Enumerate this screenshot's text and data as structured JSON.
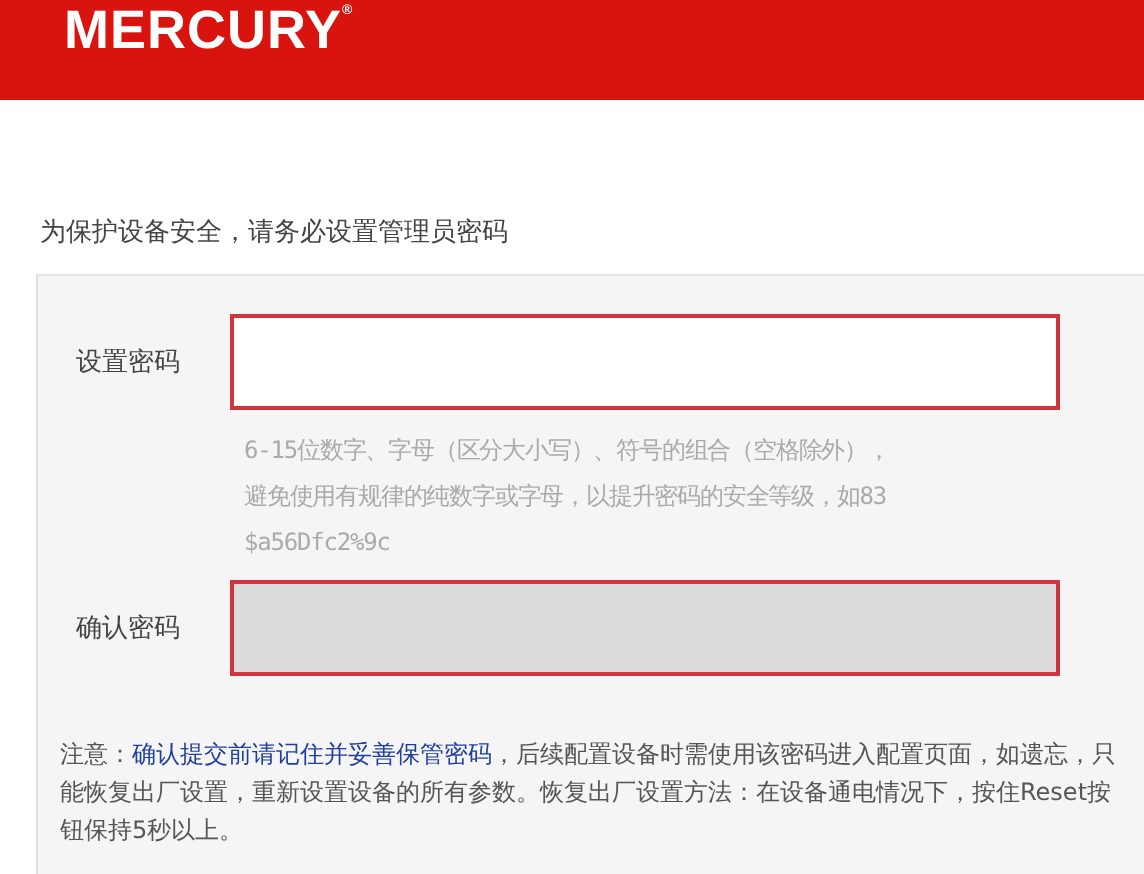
{
  "header": {
    "logo": "MERCURY",
    "trademark": "®"
  },
  "intro": "为保护设备安全，请务必设置管理员密码",
  "fields": [
    {
      "label": "设置密码",
      "disabled": false,
      "hint": [
        "6-15位数字、字母（区分大小写）、符号的组合（空格除外），",
        "避免使用有规律的纯数字或字母，以提升密码的安全等级，如83",
        "$a56Dfc2%9c"
      ]
    },
    {
      "label": "确认密码",
      "disabled": true
    }
  ],
  "note": "注意：**确认提交前请记住并妥善保管密码**，后续配置设备时需使用该密码进入配置页面，如遗忘，只能恢复出厂设置，重新设置设备的所有参数。恢复出厂设置方法：在设备通电情况下，按住Reset按钮保持5秒以上。"
}
